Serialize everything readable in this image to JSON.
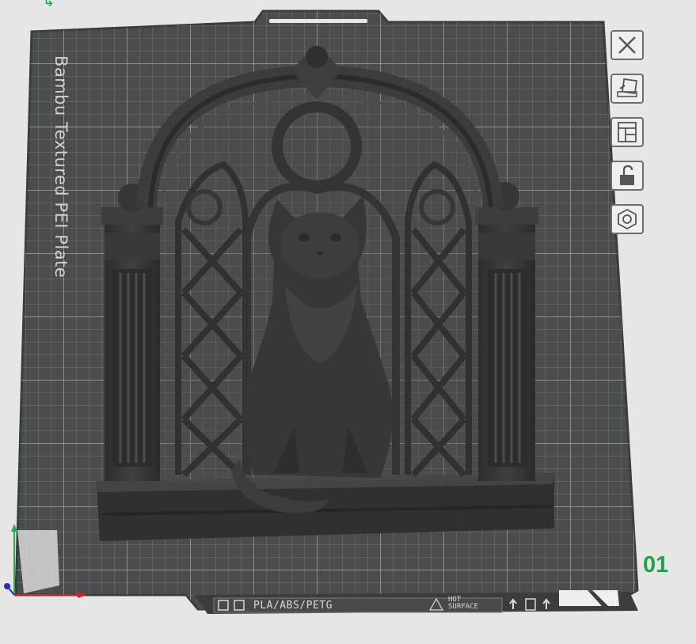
{
  "plate": {
    "label": "Bambu Textured PEI Plate",
    "number": "01",
    "material_types": "PLA/ABS/PETG",
    "hot_surface": [
      "HOT",
      "SURFACE"
    ]
  },
  "toolbar": {
    "items": [
      {
        "icon": "close-icon"
      },
      {
        "icon": "auto-orient-icon"
      },
      {
        "icon": "arrange-icon"
      },
      {
        "icon": "lock-icon"
      },
      {
        "icon": "settings-icon"
      }
    ]
  },
  "colors": {
    "background": "#e6e6e6",
    "plate": "#4a4d4e",
    "grid": "#8a8d8e",
    "model": "#333435",
    "accent": "#1fa24a"
  }
}
